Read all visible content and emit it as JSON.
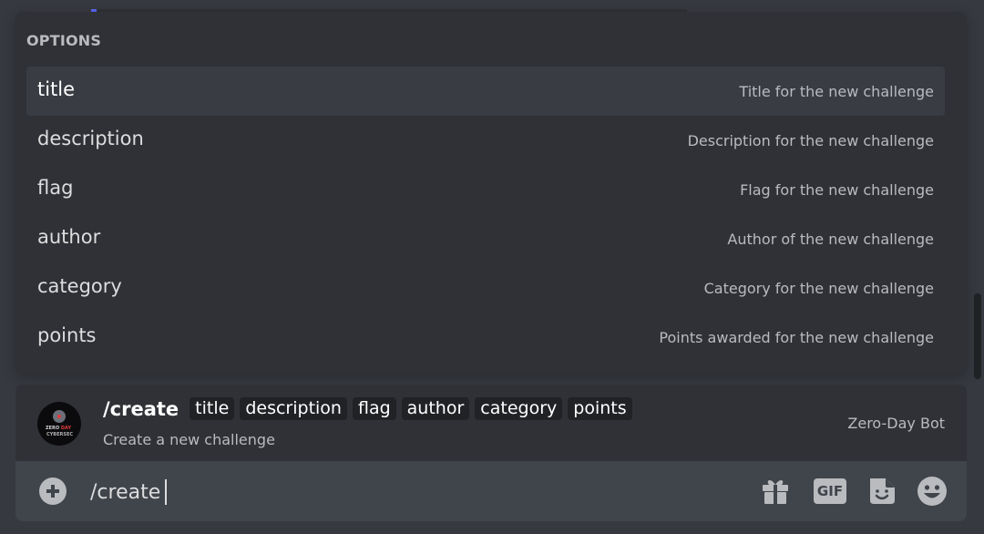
{
  "options": {
    "header": "OPTIONS",
    "items": [
      {
        "name": "title",
        "description": "Title for the new challenge"
      },
      {
        "name": "description",
        "description": "Description for the new challenge"
      },
      {
        "name": "flag",
        "description": "Flag for the new challenge"
      },
      {
        "name": "author",
        "description": "Author of the new challenge"
      },
      {
        "name": "category",
        "description": "Category for the new challenge"
      },
      {
        "name": "points",
        "description": "Points awarded for the new challenge"
      }
    ],
    "selected_index": 0
  },
  "command": {
    "name": "/create",
    "params": [
      "title",
      "description",
      "flag",
      "author",
      "category",
      "points"
    ],
    "description": "Create a new challenge",
    "bot_name": "Zero-Day Bot",
    "avatar_text_line1_a": "ZERO",
    "avatar_text_line1_b": "DAY",
    "avatar_text_line2": "CYBERSEC"
  },
  "composer": {
    "value": "/create",
    "icons": [
      "plus-icon",
      "gift-icon",
      "gif-icon",
      "sticker-icon",
      "emoji-icon"
    ],
    "gif_label": "GIF"
  },
  "colors": {
    "background": "#36393f",
    "popout": "#2f3136",
    "composer": "#40444b",
    "chip": "#202225",
    "text_muted": "#b9bbbe"
  }
}
